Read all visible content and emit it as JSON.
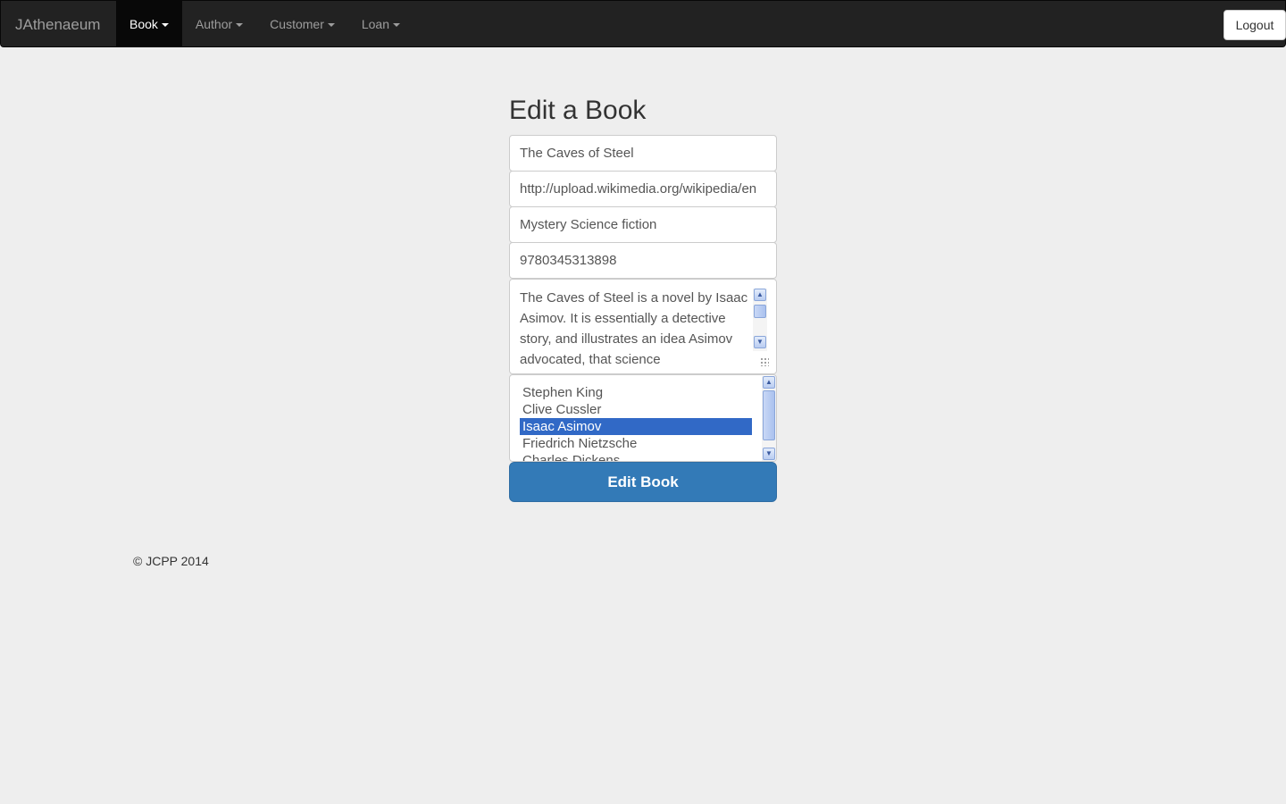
{
  "navbar": {
    "brand": "JAthenaeum",
    "items": [
      {
        "label": "Book",
        "active": true
      },
      {
        "label": "Author",
        "active": false
      },
      {
        "label": "Customer",
        "active": false
      },
      {
        "label": "Loan",
        "active": false
      }
    ],
    "logout_label": "Logout"
  },
  "form": {
    "title": "Edit a Book",
    "title_value": "The Caves of Steel",
    "image_url_value": "http://upload.wikimedia.org/wikipedia/en",
    "genre_value": "Mystery Science fiction",
    "isbn_value": "9780345313898",
    "description_value": "The Caves of Steel is a novel by Isaac Asimov. It is essentially a detective story, and illustrates an idea Asimov advocated, that science",
    "authors": [
      "Stephen King",
      "Clive Cussler",
      "Isaac Asimov",
      "Friedrich Nietzsche",
      "Charles Dickens"
    ],
    "selected_author": "Isaac Asimov",
    "submit_label": "Edit Book"
  },
  "footer": {
    "copyright": "© JCPP 2014"
  },
  "colors": {
    "navbar_bg": "#222222",
    "active_nav_bg": "#080808",
    "primary_button": "#337ab7",
    "selected_option": "#3169c6",
    "page_bg": "#eeeeee"
  }
}
